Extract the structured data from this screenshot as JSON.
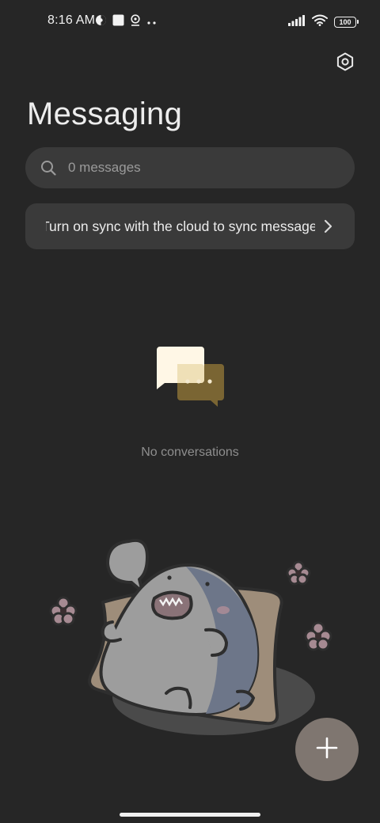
{
  "status_bar": {
    "time": "8:16 AM",
    "battery_level": "100",
    "left_icons": [
      "vpn-icon",
      "square-notification-icon",
      "location-icon",
      "more-notifications-icon"
    ],
    "right_icons": [
      "signal-icon",
      "wifi-icon",
      "battery-icon"
    ]
  },
  "header": {
    "title": "Messaging",
    "settings_icon": "settings-hexagon-icon"
  },
  "search": {
    "placeholder": "0 messages",
    "icon": "search-icon"
  },
  "sync_banner": {
    "text": "Turn on sync with the cloud to sync messages",
    "icon": "chevron-right-icon"
  },
  "empty_state": {
    "text": "No conversations",
    "icon": "chat-bubbles-icon"
  },
  "fab": {
    "icon": "plus-icon"
  },
  "colors": {
    "background": "#262626",
    "surface": "#3a3a3a",
    "fab": "#7f7670",
    "bubble_front": "#fff7e6",
    "bubble_back": "#7a6533"
  }
}
